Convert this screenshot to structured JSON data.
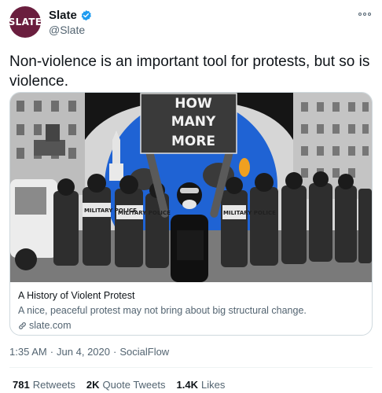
{
  "author": {
    "avatar_text": "SLATE",
    "display_name": "Slate",
    "handle": "@Slate"
  },
  "tweet": {
    "text": "Non-violence is an important tool for protests, but so is violence."
  },
  "card": {
    "sign_lines": [
      "HOW",
      "MANY",
      "MORE"
    ],
    "vest_texts": [
      "MILITARY POLICE",
      "MILITARY POLICE",
      "MILITARY POLICE"
    ],
    "title": "A History of Violent Protest",
    "description": "A nice, peaceful protest may not bring about big structural change.",
    "domain": "slate.com"
  },
  "meta": {
    "time": "1:35 AM",
    "sep1": "·",
    "date": "Jun 4, 2020",
    "sep2": "·",
    "source": "SocialFlow"
  },
  "stats": {
    "retweets_count": "781",
    "retweets_label": "Retweets",
    "quotes_count": "2K",
    "quotes_label": "Quote Tweets",
    "likes_count": "1.4K",
    "likes_label": "Likes"
  },
  "colors": {
    "avatar_bg": "#6a1e3e",
    "verified": "#1d9bf0",
    "image_circle": "#1f63d4",
    "secondary_text": "#536471"
  },
  "icons": [
    "verified-badge-icon",
    "more-options-icon",
    "link-icon"
  ]
}
